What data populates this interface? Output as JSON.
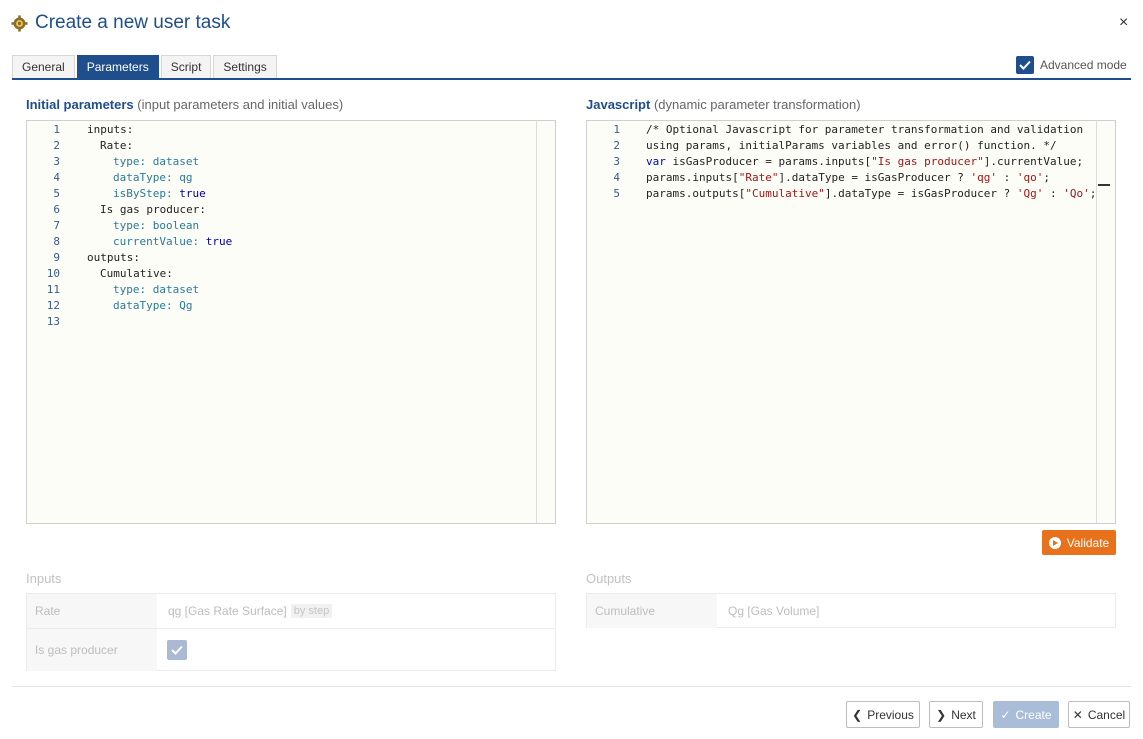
{
  "header": {
    "title": "Create a new user task",
    "close_label": "×"
  },
  "tabs": [
    "General",
    "Parameters",
    "Script",
    "Settings"
  ],
  "active_tab": "Parameters",
  "advanced_mode": {
    "label": "Advanced mode",
    "checked": true
  },
  "initial_params": {
    "title": "Initial parameters",
    "subtitle": "(input parameters and initial values)"
  },
  "javascript": {
    "title": "Javascript",
    "subtitle": "(dynamic parameter transformation)"
  },
  "yaml_lines": [
    "1",
    "2",
    "3",
    "4",
    "5",
    "6",
    "7",
    "8",
    "9",
    "10",
    "11",
    "12",
    "13"
  ],
  "js_lines": [
    "1",
    "2",
    "3",
    "4",
    "5"
  ],
  "yaml": {
    "l1": "inputs:",
    "l2": "Rate:",
    "l3k": "type:",
    "l3v": " dataset",
    "l4k": "dataType:",
    "l4v": " qg",
    "l5k": "isByStep:",
    "l5v": " true",
    "l6": "Is gas producer:",
    "l7k": "type:",
    "l7v": " boolean",
    "l8k": "currentValue:",
    "l8v": " true",
    "l9": "outputs:",
    "l10": "Cumulative:",
    "l11k": "type:",
    "l11v": " dataset",
    "l12k": "dataType:",
    "l12v": " Qg"
  },
  "js": {
    "c1": "/* Optional Javascript for parameter transformation and validation",
    "c2": "using params, initialParams variables and error() function. */",
    "l3a": "var",
    "l3b": " isGasProducer = params.inputs[",
    "l3c": "\"Is gas producer\"",
    "l3d": "].currentValue;",
    "l4a": "params.inputs[",
    "l4b": "\"Rate\"",
    "l4c": "].dataType = isGasProducer ? ",
    "l4d": "'qg'",
    "l4e": " : ",
    "l4f": "'qo'",
    "l4g": ";",
    "l5a": "params.outputs[",
    "l5b": "\"Cumulative\"",
    "l5c": "].dataType = isGasProducer ? ",
    "l5d": "'Qg'",
    "l5e": " : ",
    "l5f": "'Qo'",
    "l5g": ";"
  },
  "validate_label": "Validate",
  "inputs_section": {
    "title": "Inputs",
    "rows": [
      {
        "name": "Rate",
        "value": "qg [Gas Rate Surface]",
        "tag": "by step"
      },
      {
        "name": "Is gas producer",
        "checked": true
      }
    ]
  },
  "outputs_section": {
    "title": "Outputs",
    "rows": [
      {
        "name": "Cumulative",
        "value": "Qg [Gas Volume]"
      }
    ]
  },
  "footer": {
    "previous": "Previous",
    "next": "Next",
    "create": "Create",
    "cancel": "Cancel"
  }
}
